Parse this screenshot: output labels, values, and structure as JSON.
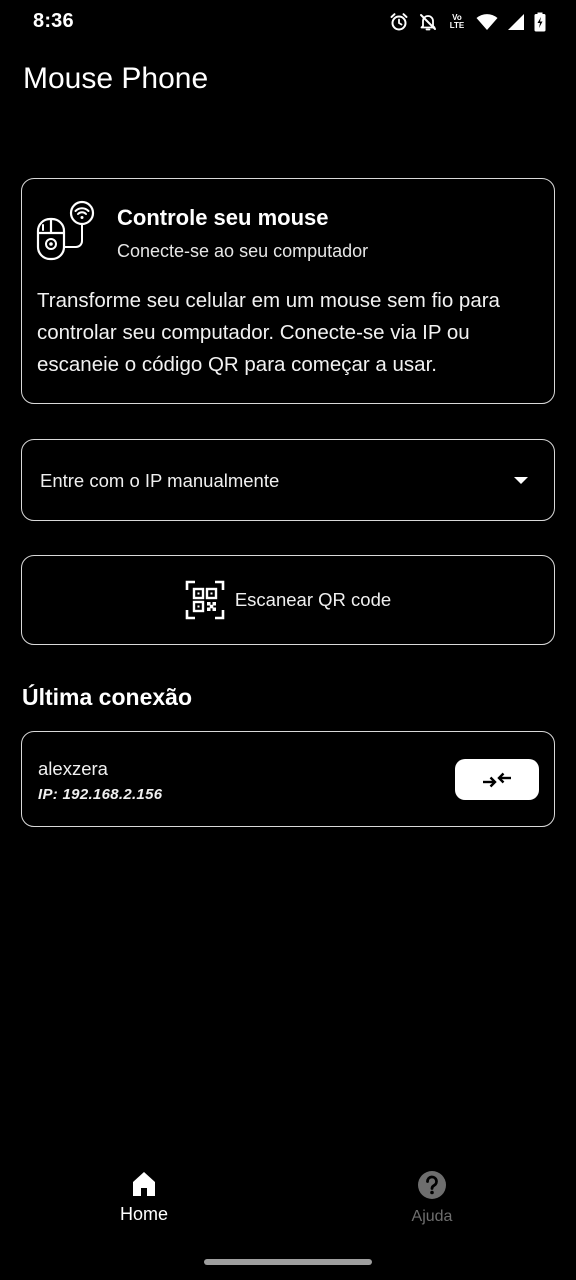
{
  "status_bar": {
    "time": "8:36",
    "network_lte_top": "Vo",
    "network_lte_bottom": "LTE"
  },
  "app": {
    "title": "Mouse Phone"
  },
  "info_card": {
    "title": "Controle seu mouse",
    "subtitle": "Conecte-se ao seu computador",
    "body": "Transforme seu celular em um mouse sem fio para controlar seu computador. Conecte-se via IP ou escaneie o código QR para começar a usar."
  },
  "ip_dropdown": {
    "label": "Entre com o IP manualmente"
  },
  "qr_button": {
    "label": "Escanear QR code"
  },
  "last_connection": {
    "title": "Última conexão",
    "name": "alexzera",
    "ip": "IP: 192.168.2.156"
  },
  "bottom_nav": {
    "items": [
      {
        "label": "Home",
        "icon": "home-icon",
        "active": true
      },
      {
        "label": "Ajuda",
        "icon": "help-icon",
        "active": false
      }
    ]
  },
  "colors": {
    "background": "#000000",
    "foreground": "#ffffff",
    "inactive": "#6e6e6e"
  }
}
